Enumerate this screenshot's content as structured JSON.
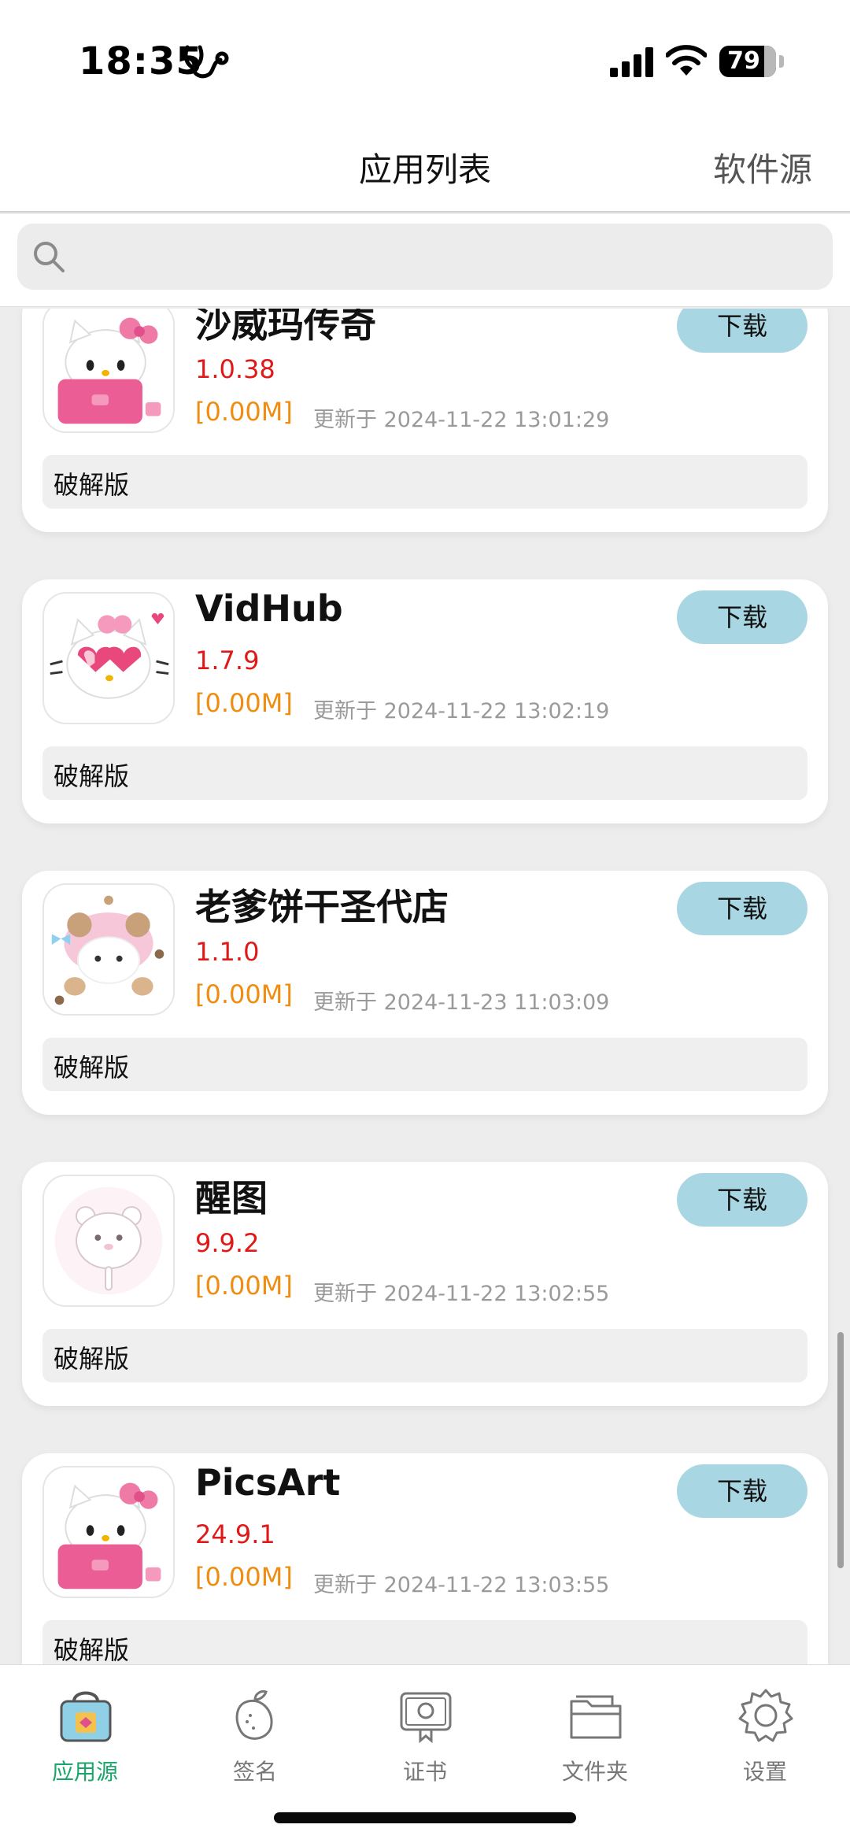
{
  "status_bar": {
    "time": "18:35",
    "battery": "79",
    "battery_level": 0.79
  },
  "nav": {
    "title": "应用列表",
    "right_action": "软件源"
  },
  "search": {
    "placeholder": "",
    "value": ""
  },
  "apps": [
    {
      "name": "沙威玛传奇",
      "version": "1.0.38",
      "size": "[0.00M]",
      "updated": "更新于 2024-11-22 13:01:29",
      "button": "下载",
      "tag": "破解版",
      "icon": "hello-kitty-laptop-icon"
    },
    {
      "name": "VidHub",
      "version": "1.7.9",
      "size": "[0.00M]",
      "updated": "更新于 2024-11-22 13:02:19",
      "button": "下载",
      "tag": "破解版",
      "icon": "hello-kitty-heart-glasses-icon"
    },
    {
      "name": "老爹饼干圣代店",
      "version": "1.1.0",
      "size": "[0.00M]",
      "updated": "更新于 2024-11-23 11:03:09",
      "button": "下载",
      "tag": "破解版",
      "icon": "pink-sheep-icon"
    },
    {
      "name": "醒图",
      "version": "9.9.2",
      "size": "[0.00M]",
      "updated": "更新于 2024-11-22 13:02:55",
      "button": "下载",
      "tag": "破解版",
      "icon": "white-bear-icon"
    },
    {
      "name": "PicsArt",
      "version": "24.9.1",
      "size": "[0.00M]",
      "updated": "更新于 2024-11-22 13:03:55",
      "button": "下载",
      "tag": "破解版",
      "icon": "hello-kitty-laptop-icon"
    }
  ],
  "tabs": [
    {
      "label": "应用源",
      "icon": "shopping-bag-icon",
      "active": true
    },
    {
      "label": "签名",
      "icon": "mango-icon",
      "active": false
    },
    {
      "label": "证书",
      "icon": "certificate-icon",
      "active": false
    },
    {
      "label": "文件夹",
      "icon": "folder-icon",
      "active": false
    },
    {
      "label": "设置",
      "icon": "gear-icon",
      "active": false
    }
  ],
  "colors": {
    "accent_green": "#1aa66b",
    "download_button": "#a9d6e3",
    "version_red": "#e01818",
    "size_orange": "#f08c10"
  }
}
